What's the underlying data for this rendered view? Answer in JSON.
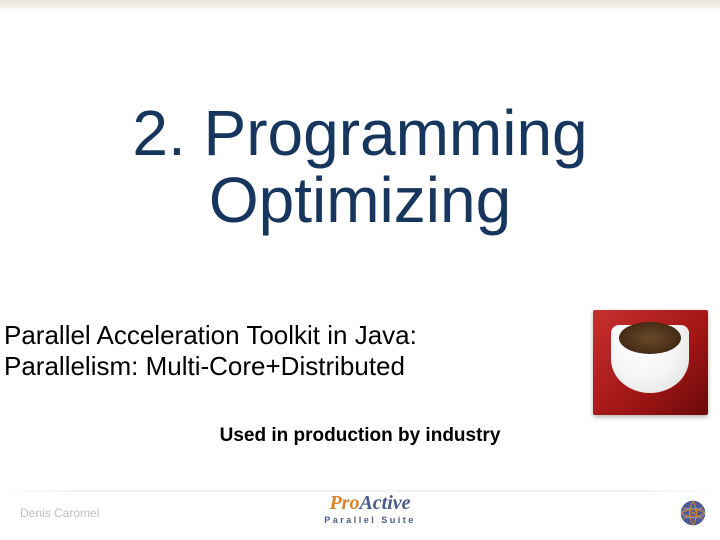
{
  "title": {
    "line1": "2. Programming",
    "line2": "Optimizing"
  },
  "subtitle": {
    "line1": "Parallel Acceleration Toolkit in Java:",
    "line2": "Parallelism: Multi-Core+Distributed"
  },
  "tagline": "Used in production by industry",
  "footer": {
    "author": "Denis Caromel",
    "logo_main_1": "Pro",
    "logo_main_2": "Active",
    "logo_sub": "Parallel Suite"
  }
}
